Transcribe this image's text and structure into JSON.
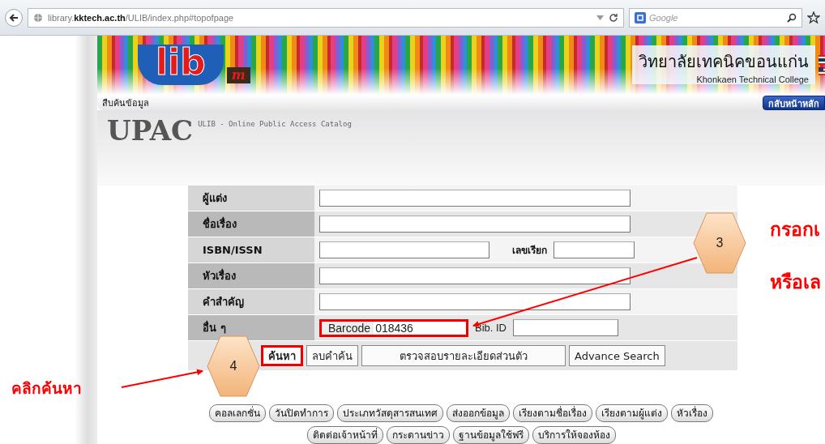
{
  "browser": {
    "url": "library.**kktech.ac.th**/ULIB/index.php#topofpage",
    "search_placeholder": "Google"
  },
  "banner": {
    "logo_text": "lib",
    "logo_mark": "m",
    "college_th": "วิทยาลัยเทคนิคขอนแก่น",
    "college_en": "Khonkaen Technical College"
  },
  "nav": {
    "title": "สืบค้นข้อมูล",
    "home_button": "กลับหน้าหลัก"
  },
  "catalog": {
    "title": "UPAC",
    "subtitle": "ULIB - Online Public Access Catalog"
  },
  "form": {
    "rows": [
      {
        "kind": "text",
        "label": "ผู้แต่ง"
      },
      {
        "kind": "text",
        "label": "ชื่อเรื่อง"
      },
      {
        "kind": "pair",
        "label": "ISBN/ISSN",
        "second_label": "เลขเรียก"
      },
      {
        "kind": "text",
        "label": "หัวเรื่อง"
      },
      {
        "kind": "text",
        "label": "คำสำคัญ"
      },
      {
        "kind": "other",
        "label": "อื่น ๆ",
        "field_label": "Barcode",
        "value": "018436",
        "second_label": "Bib. ID",
        "highlighted": true
      }
    ],
    "buttons": [
      {
        "label": "ค้นหา",
        "highlighted": true
      },
      {
        "label": "ลบคำค้น",
        "highlighted": false
      },
      {
        "label": "ตรวจสอบรายละเอียดส่วนตัว",
        "highlighted": false
      },
      {
        "label": "Advance Search",
        "highlighted": false
      }
    ]
  },
  "links": [
    [
      "คอลเลกชั่น",
      "วันปิดทำการ",
      "ประเภทวัสดุสารสนเทศ",
      "ส่งออกข้อมูล",
      "เรียงตามชื่อเรื่อง",
      "เรียงตามผู้แต่ง",
      "หัวเรื่อง"
    ],
    [
      "ติดต่อเจ้าหน้าที่",
      "กระดานข่าว",
      "ฐานข้อมูลใช้ฟรี",
      "บริการให้จองห้อง"
    ]
  ],
  "annotations": {
    "steps": [
      "3",
      "4"
    ],
    "notes": [
      "กรอกเ",
      "หรือเล",
      "คลิกค้นหา"
    ]
  }
}
